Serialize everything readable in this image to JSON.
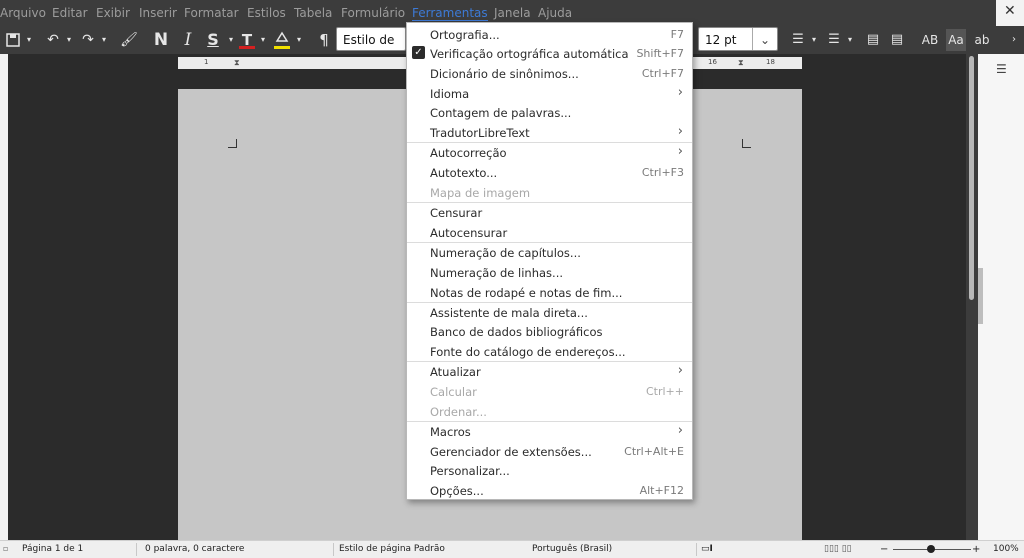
{
  "menubar": {
    "items": [
      "Arquivo",
      "Editar",
      "Exibir",
      "Inserir",
      "Formatar",
      "Estilos",
      "Tabela",
      "Formulário",
      "Ferramentas",
      "Janela",
      "Ajuda"
    ],
    "active": "Ferramentas"
  },
  "toolbar": {
    "paragraph_style": "Estilo de parágrafo",
    "font_size": "12 pt",
    "bold_glyph": "N",
    "italic_glyph": "I",
    "underline_glyph": "S",
    "font_color_glyph": "T",
    "pilcrow_glyph": "¶",
    "glyph_ab1": "AB",
    "glyph_aa": "Aa",
    "glyph_ab2": "ab"
  },
  "ruler": {
    "numbers": [
      "1",
      "16",
      "18"
    ]
  },
  "tools_menu": {
    "items": [
      {
        "label": "Ortografia...",
        "shortcut": "F7"
      },
      {
        "label": "Verificação ortográfica automática",
        "shortcut": "Shift+F7",
        "checked": true
      },
      {
        "label": "Dicionário de sinônimos...",
        "shortcut": "Ctrl+F7"
      },
      {
        "label": "Idioma",
        "submenu": true
      },
      {
        "label": "Contagem de palavras..."
      },
      {
        "label": "TradutorLibreText",
        "submenu": true
      },
      {
        "label": "Autocorreção",
        "submenu": true
      },
      {
        "label": "Autotexto...",
        "shortcut": "Ctrl+F3"
      },
      {
        "label": "Mapa de imagem",
        "disabled": true
      },
      {
        "label": "Censurar"
      },
      {
        "label": "Autocensurar"
      },
      {
        "label": "Numeração de capítulos..."
      },
      {
        "label": "Numeração de linhas..."
      },
      {
        "label": "Notas de rodapé e notas de fim..."
      },
      {
        "label": "Assistente de mala direta..."
      },
      {
        "label": "Banco de dados bibliográficos"
      },
      {
        "label": "Fonte do catálogo de endereços..."
      },
      {
        "label": "Atualizar",
        "submenu": true
      },
      {
        "label": "Calcular",
        "shortcut": "Ctrl++",
        "disabled": true
      },
      {
        "label": "Ordenar...",
        "disabled": true
      },
      {
        "label": "Macros",
        "submenu": true
      },
      {
        "label": "Gerenciador de extensões...",
        "shortcut": "Ctrl+Alt+E"
      },
      {
        "label": "Personalizar..."
      },
      {
        "label": "Opções...",
        "shortcut": "Alt+F12"
      }
    ]
  },
  "statusbar": {
    "page": "Página 1 de 1",
    "words": "0 palavra, 0 caractere",
    "page_style": "Estilo de página Padrão",
    "language": "Português (Brasil)",
    "zoom": "100%"
  },
  "colors": {
    "accent": "#3d7ad6",
    "font_color_bar": "#d42020",
    "highlight_bar": "#f0e000"
  }
}
